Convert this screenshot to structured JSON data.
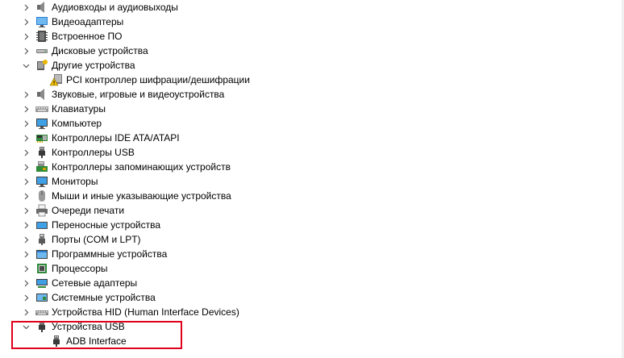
{
  "tree": {
    "items": [
      {
        "label": "Аудиовходы и аудиовыходы",
        "icon": "speaker-icon",
        "expanded": false
      },
      {
        "label": "Видеоадаптеры",
        "icon": "display-adapter-icon",
        "expanded": false
      },
      {
        "label": "Встроенное ПО",
        "icon": "firmware-icon",
        "expanded": false
      },
      {
        "label": "Дисковые устройства",
        "icon": "disk-drive-icon",
        "expanded": false
      },
      {
        "label": "Другие устройства",
        "icon": "other-devices-icon",
        "expanded": true
      },
      {
        "label": "PCI контроллер шифрации/дешифрации",
        "icon": "warning-device-icon",
        "child": true
      },
      {
        "label": "Звуковые, игровые и видеоустройства",
        "icon": "speaker-icon",
        "expanded": false
      },
      {
        "label": "Клавиатуры",
        "icon": "keyboard-icon",
        "expanded": false
      },
      {
        "label": "Компьютер",
        "icon": "monitor-icon",
        "expanded": false
      },
      {
        "label": "Контроллеры IDE ATA/ATAPI",
        "icon": "ide-controller-icon",
        "expanded": false
      },
      {
        "label": "Контроллеры USB",
        "icon": "usb-icon",
        "expanded": false
      },
      {
        "label": "Контроллеры запоминающих устройств",
        "icon": "storage-controller-icon",
        "expanded": false
      },
      {
        "label": "Мониторы",
        "icon": "monitor-icon",
        "expanded": false
      },
      {
        "label": "Мыши и иные указывающие устройства",
        "icon": "mouse-icon",
        "expanded": false
      },
      {
        "label": "Очереди печати",
        "icon": "printer-icon",
        "expanded": false
      },
      {
        "label": "Переносные устройства",
        "icon": "portable-device-icon",
        "expanded": false
      },
      {
        "label": "Порты (COM и LPT)",
        "icon": "port-icon",
        "expanded": false
      },
      {
        "label": "Программные устройства",
        "icon": "software-device-icon",
        "expanded": false
      },
      {
        "label": "Процессоры",
        "icon": "processor-icon",
        "expanded": false
      },
      {
        "label": "Сетевые адаптеры",
        "icon": "network-adapter-icon",
        "expanded": false
      },
      {
        "label": "Системные устройства",
        "icon": "system-device-icon",
        "expanded": false
      },
      {
        "label": "Устройства HID (Human Interface Devices)",
        "icon": "hid-icon",
        "expanded": false
      },
      {
        "label": "Устройства USB",
        "icon": "usb-icon",
        "expanded": true
      },
      {
        "label": "ADB Interface",
        "icon": "usb-icon",
        "child": true
      }
    ]
  },
  "colors": {
    "highlight": "#e0001b",
    "chevron": "#555555"
  }
}
